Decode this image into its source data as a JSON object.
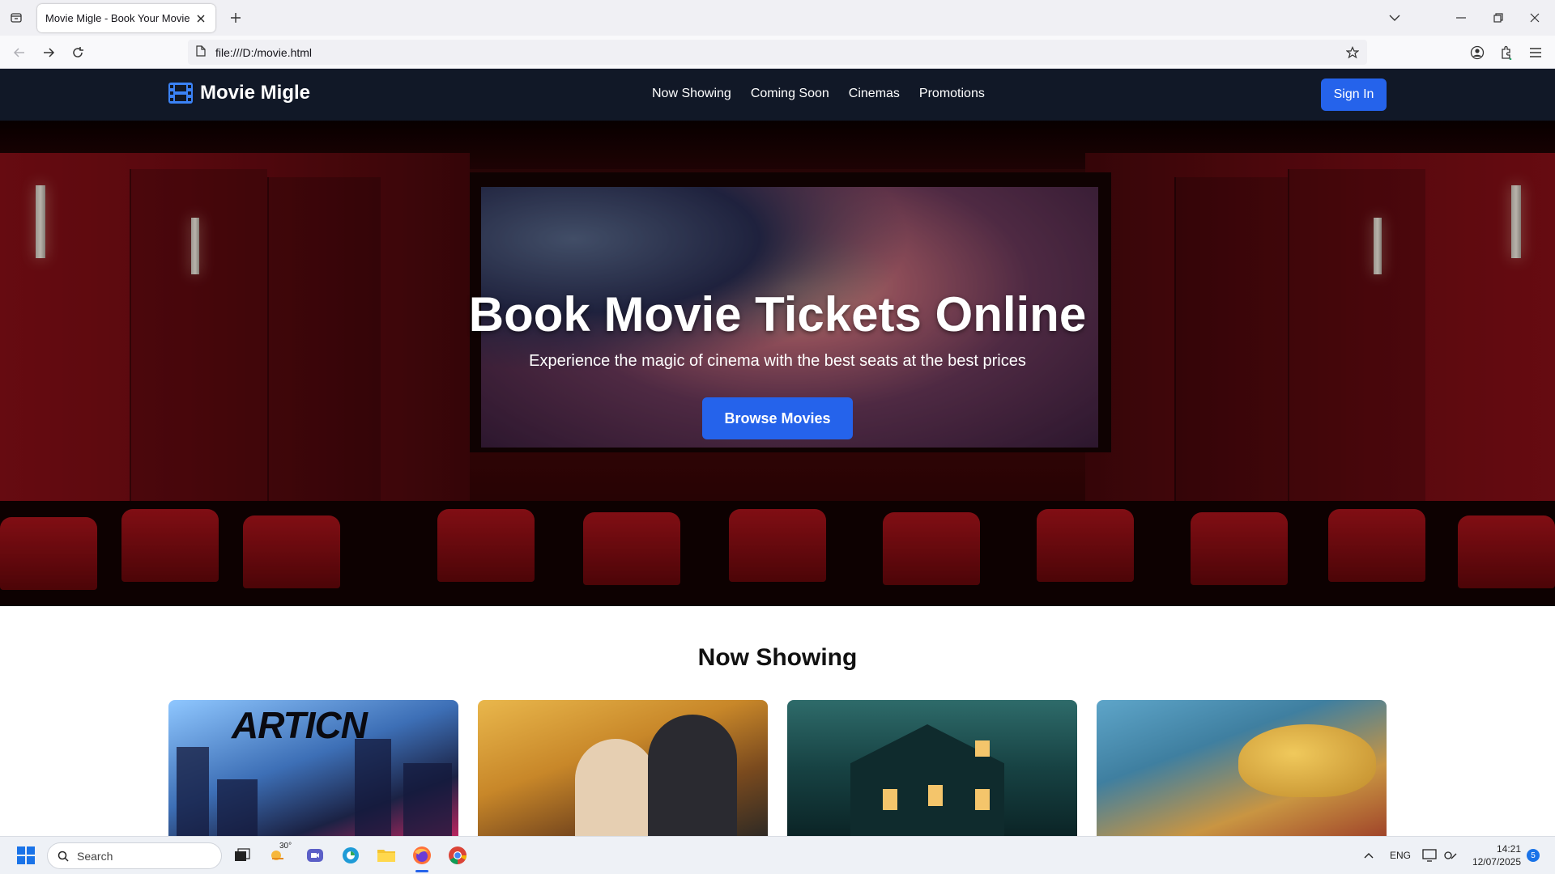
{
  "browser": {
    "tab_title": "Movie Migle - Book Your Movie Tick",
    "url": "file:///D:/movie.html"
  },
  "site": {
    "logo_text": "Movie Migle",
    "nav": [
      "Now Showing",
      "Coming Soon",
      "Cinemas",
      "Promotions"
    ],
    "signin_label": "Sign In"
  },
  "hero": {
    "title": "Book Movie Tickets Online",
    "subtitle": "Experience the magic of cinema with the best seats at the best prices",
    "cta_label": "Browse Movies"
  },
  "now_showing": {
    "heading": "Now Showing",
    "poster_1_text": "ARTICN"
  },
  "taskbar": {
    "search_placeholder": "Search",
    "weather_temp": "30°",
    "language": "ENG",
    "time": "14:21",
    "date": "12/07/2025",
    "notification_count": "5"
  },
  "colors": {
    "header_bg": "#111827",
    "accent": "#2563eb"
  },
  "icons": [
    "tab-list-icon",
    "close-icon",
    "plus-icon",
    "chevron-down-icon",
    "minimize-icon",
    "restore-icon",
    "back-arrow-icon",
    "forward-arrow-icon",
    "reload-icon",
    "page-icon",
    "bookmark-star-icon",
    "account-icon",
    "extensions-icon",
    "menu-icon",
    "film-icon",
    "windows-start-icon",
    "search-icon",
    "weather-icon",
    "file-explorer-icon",
    "firefox-icon",
    "chrome-icon"
  ]
}
